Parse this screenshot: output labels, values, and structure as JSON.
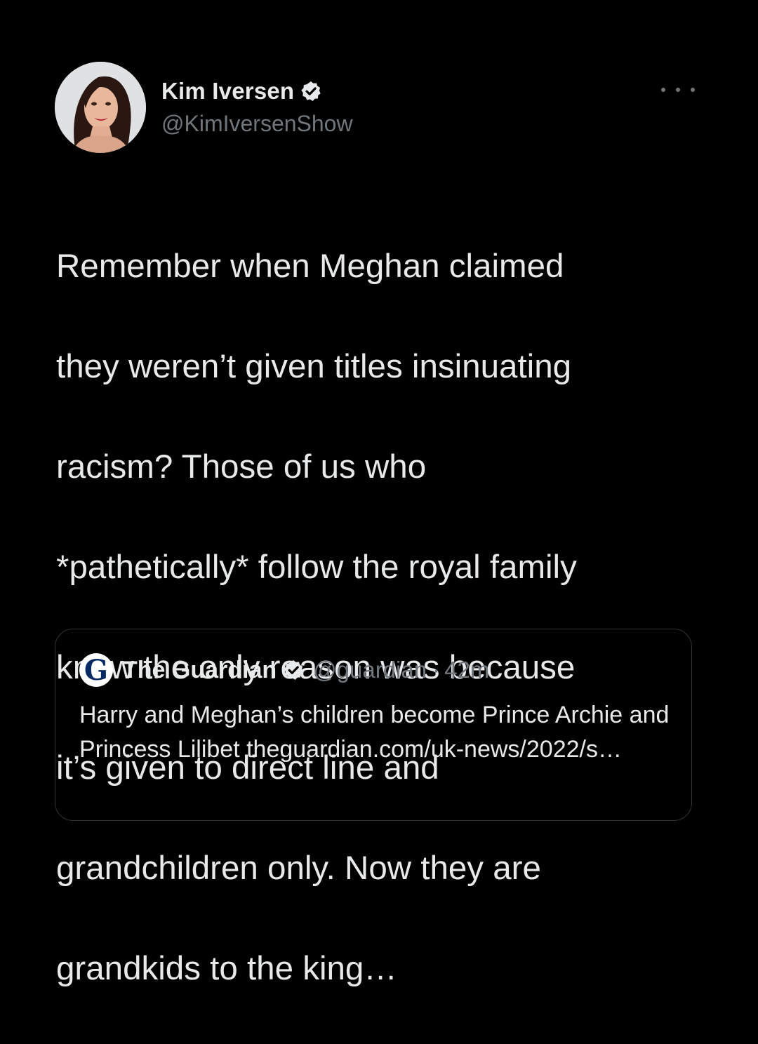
{
  "tweet": {
    "author": {
      "display_name": "Kim Iversen",
      "handle": "@KimIversenShow",
      "verified": true,
      "avatar_icon": "profile-photo"
    },
    "more_icon": "ellipsis-icon",
    "text_lines": [
      "Remember when Meghan claimed",
      "they weren’t given titles insinuating",
      "racism? Those of us who",
      "*pathetically* follow the royal family",
      "knew the only reason was because",
      "it’s given to direct line and",
      "grandchildren only. Now they are",
      "grandkids to the king…"
    ],
    "quoted": {
      "display_name": "The Guardian",
      "logo_letter": "G",
      "handle": "@guardian",
      "separator": "·",
      "time": "42m",
      "verified": true,
      "text": "Harry and Meghan’s children become Prince Archie and Princess Lilibet theguardian.com/uk-news/2022/s…"
    }
  },
  "colors": {
    "background": "#000000",
    "text_primary": "#e7e9ea",
    "text_secondary": "#71767b",
    "card_border": "#2f3336",
    "guardian_blue": "#052962"
  }
}
